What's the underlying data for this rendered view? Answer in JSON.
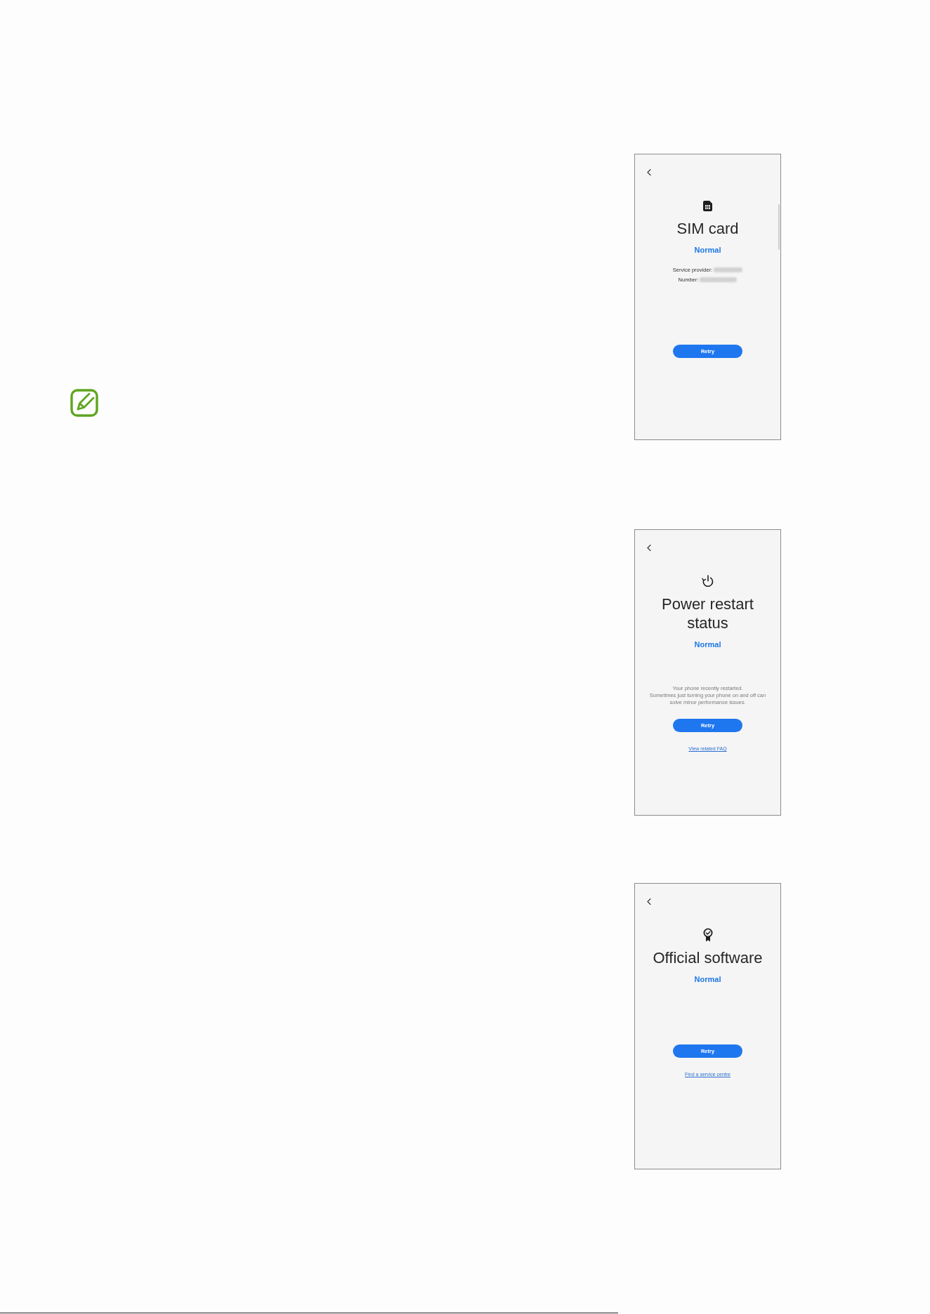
{
  "screens": [
    {
      "kind": "sim",
      "scrollable": true,
      "title": "SIM card",
      "status": "Normal",
      "details": [
        {
          "label": "Service provider:",
          "blurred": true
        },
        {
          "label": "Number:",
          "blurred": true
        }
      ],
      "button": "Retry"
    },
    {
      "kind": "restart",
      "scrollable": false,
      "title": "Power restart status",
      "status": "Normal",
      "description": [
        "Your phone recently restarted.",
        "Sometimes just turning your phone on and off can solve minor performance issues."
      ],
      "button": "Retry",
      "link": "View related FAQ"
    },
    {
      "kind": "certificate",
      "scrollable": false,
      "title": "Official software",
      "status": "Normal",
      "button": "Retry",
      "link": "Find a service centre"
    }
  ]
}
